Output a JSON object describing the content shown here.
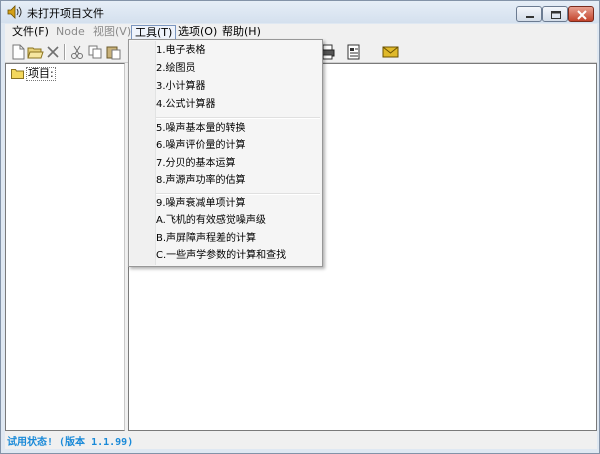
{
  "window": {
    "title": "未打开项目文件",
    "minimize_label": "",
    "maximize_label": "",
    "close_label": ""
  },
  "menubar": {
    "items": [
      {
        "label": "文件(F)",
        "enabled": true
      },
      {
        "label": "Node",
        "enabled": false
      },
      {
        "label": "视图(V)",
        "enabled": false
      },
      {
        "label": "工具(T)",
        "enabled": true,
        "active": true
      },
      {
        "label": "选项(O)",
        "enabled": true
      },
      {
        "label": "帮助(H)",
        "enabled": true
      }
    ]
  },
  "toolbar": {
    "buttons": [
      "new-file-icon",
      "open-folder-icon",
      "delete-icon",
      "cut-icon",
      "copy-icon",
      "paste-icon",
      "print-icon",
      "properties-icon",
      "mail-icon"
    ]
  },
  "tree": {
    "root_label": "项目:"
  },
  "tools_menu": {
    "groups": [
      [
        "1.电子表格",
        "2.绘图员",
        "3.小计算器",
        "4.公式计算器"
      ],
      [
        "5.噪声基本量的转换",
        "6.噪声评价量的计算",
        "7.分贝的基本运算",
        "8.声源声功率的估算"
      ],
      [
        "9.噪声衰减单项计算",
        "A.飞机的有效感觉噪声级",
        "B.声屏障声程差的计算",
        "C.一些声学参数的计算和查找"
      ]
    ]
  },
  "statusbar": {
    "text": "试用状态! (版本 1.1.99)"
  },
  "colors": {
    "status_text": "#1a8ad8",
    "title_bg": "#dfe8f2",
    "close_button": "#c2432b"
  }
}
